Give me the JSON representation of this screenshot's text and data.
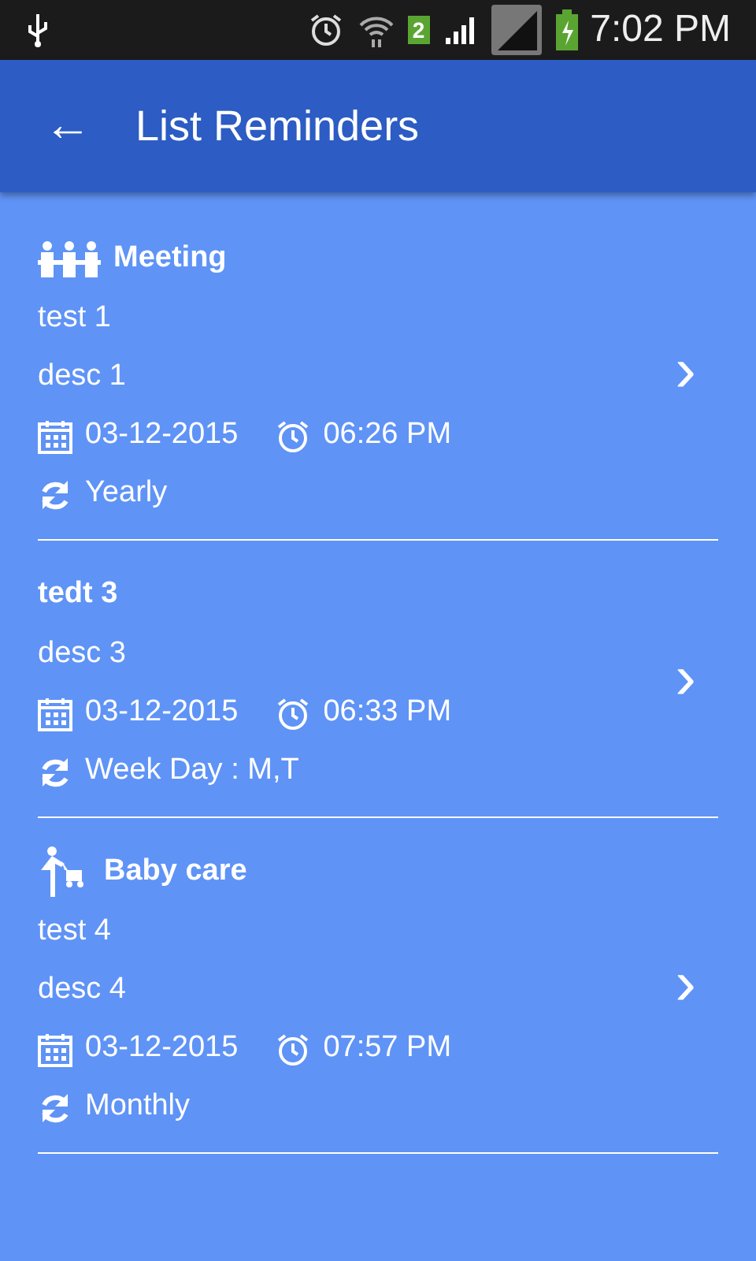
{
  "status_bar": {
    "sim_badge": "2",
    "time": "7:02 PM"
  },
  "app_bar": {
    "back": "←",
    "title": "List Reminders"
  },
  "reminders": [
    {
      "header": {
        "kind": "meeting",
        "label": "Meeting"
      },
      "title": "test 1",
      "description": "desc 1",
      "date": "03-12-2015",
      "time": "06:26 PM",
      "repeat": "Yearly",
      "chevron": "›"
    },
    {
      "header": {
        "kind": "plain",
        "label": "tedt 3"
      },
      "description": "desc 3",
      "date": "03-12-2015",
      "time": "06:33 PM",
      "repeat": "Week Day : M,T",
      "chevron": "›"
    },
    {
      "header": {
        "kind": "baby",
        "label": "Baby care"
      },
      "title": "test 4",
      "description": "desc 4",
      "date": "03-12-2015",
      "time": "07:57 PM",
      "repeat": "Monthly",
      "chevron": "›"
    }
  ]
}
